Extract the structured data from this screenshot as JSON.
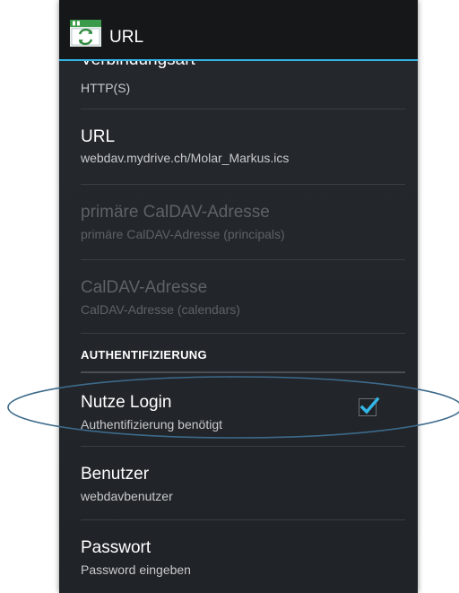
{
  "actionbar": {
    "title": "URL",
    "icon": "calendar-sync-icon",
    "accent_color": "#33b5e5"
  },
  "prefs": [
    {
      "title": "Verbindungsart",
      "summary": "HTTP(S)",
      "enabled": true
    },
    {
      "title": "URL",
      "summary": "webdav.mydrive.ch/Molar_Markus.ics",
      "enabled": true
    },
    {
      "title": "primäre CalDAV-Adresse",
      "summary": "primäre CalDAV-Adresse (principals)",
      "enabled": false
    },
    {
      "title": "CalDAV-Adresse",
      "summary": "CalDAV-Adresse (calendars)",
      "enabled": false
    }
  ],
  "section": {
    "label": "AUTHENTIFIZIERUNG"
  },
  "auth_prefs": [
    {
      "title": "Nutze Login",
      "summary": "Authentifizierung benötigt",
      "checked": true
    },
    {
      "title": "Benutzer",
      "summary": "webdavbenutzer"
    },
    {
      "title": "Passwort",
      "summary": "Password eingeben"
    }
  ],
  "colors": {
    "background": "#222529",
    "checkmark": "#33b5e5",
    "annotation_ellipse": "#3c6a8a"
  }
}
